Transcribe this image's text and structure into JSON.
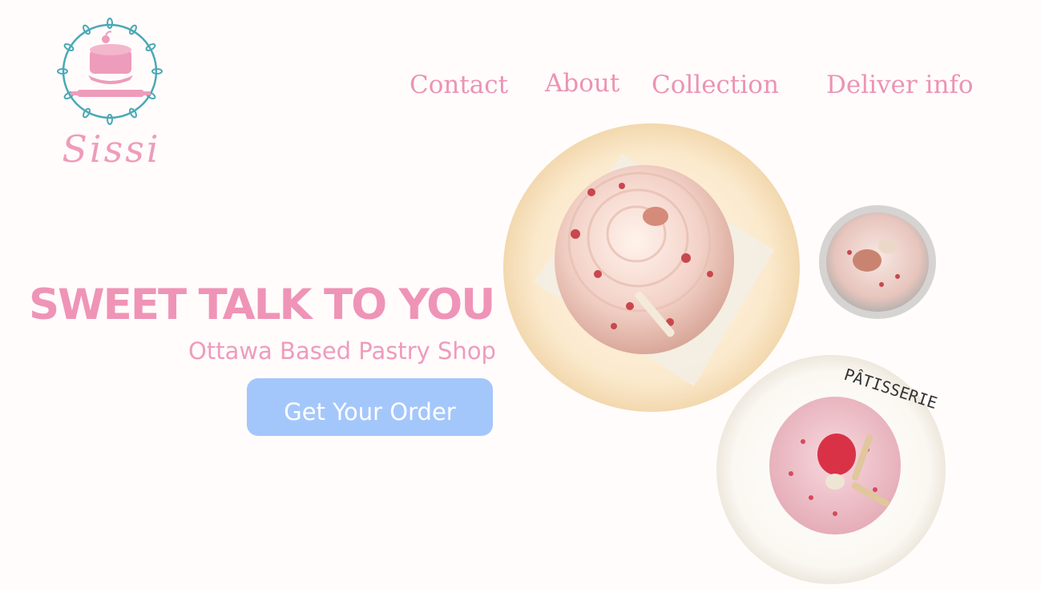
{
  "brand": {
    "name": "Sissi",
    "colors": {
      "pink": "#ee9cbb",
      "teal": "#4aa9b5",
      "button_blue": "#a4c7fb",
      "background": "#fffcfb"
    }
  },
  "nav": {
    "items": [
      {
        "label": "Contact"
      },
      {
        "label": "About"
      },
      {
        "label": "Collection"
      },
      {
        "label": "Deliver info"
      }
    ]
  },
  "hero": {
    "title": "SWEET TALK TO YOU",
    "subtitle": "Ottawa Based Pastry Shop",
    "cta_label": "Get Your Order"
  },
  "photos": {
    "plate_lettering": "PÂTISSERIE"
  },
  "icons": {
    "logo": "cake-wreath-logo-icon"
  }
}
